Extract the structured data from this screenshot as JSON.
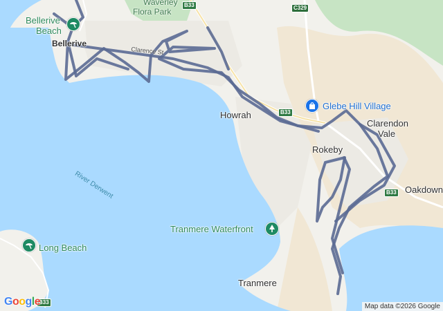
{
  "map": {
    "colors": {
      "water": "#aadaff",
      "land": "#f2f1ec",
      "park": "#c7e4c4",
      "sand": "#f1e7d4",
      "route": "#5b6a94",
      "poi_green": "#1e8a63",
      "shop_blue": "#1a73e8"
    },
    "labels": {
      "waverley": "Waverley",
      "flora_park": "Flora Park",
      "bellerive_beach_1": "Bellerive",
      "bellerive_beach_2": "Beach",
      "bellerive": "Bellerive",
      "clarence_st": "Clarence St",
      "howrah": "Howrah",
      "rokeby": "Rokeby",
      "clarendon_1": "Clarendon",
      "clarendon_2": "Vale",
      "oakdowns": "Oakdown",
      "river_derwent": "River Derwent",
      "long_beach": "Long Beach",
      "tranmere_waterfront": "Tranmere Waterfront",
      "tranmere": "Tranmere",
      "glebe_hill": "Glebe Hill Village"
    },
    "shields": {
      "b33_top": "B33",
      "c329": "C329",
      "b33_mid": "B33",
      "b33_right": "B33",
      "b33_bottom": "B33"
    },
    "icons": {
      "beach_pin": "beach-umbrella-icon",
      "park_pin": "tree-icon",
      "shop_pin": "shopping-bag-icon"
    },
    "attribution": "Map data ©2026 Google",
    "logo": {
      "G": "G",
      "o1": "o",
      "o2": "o",
      "g": "g",
      "l": "l",
      "e": "e"
    }
  }
}
